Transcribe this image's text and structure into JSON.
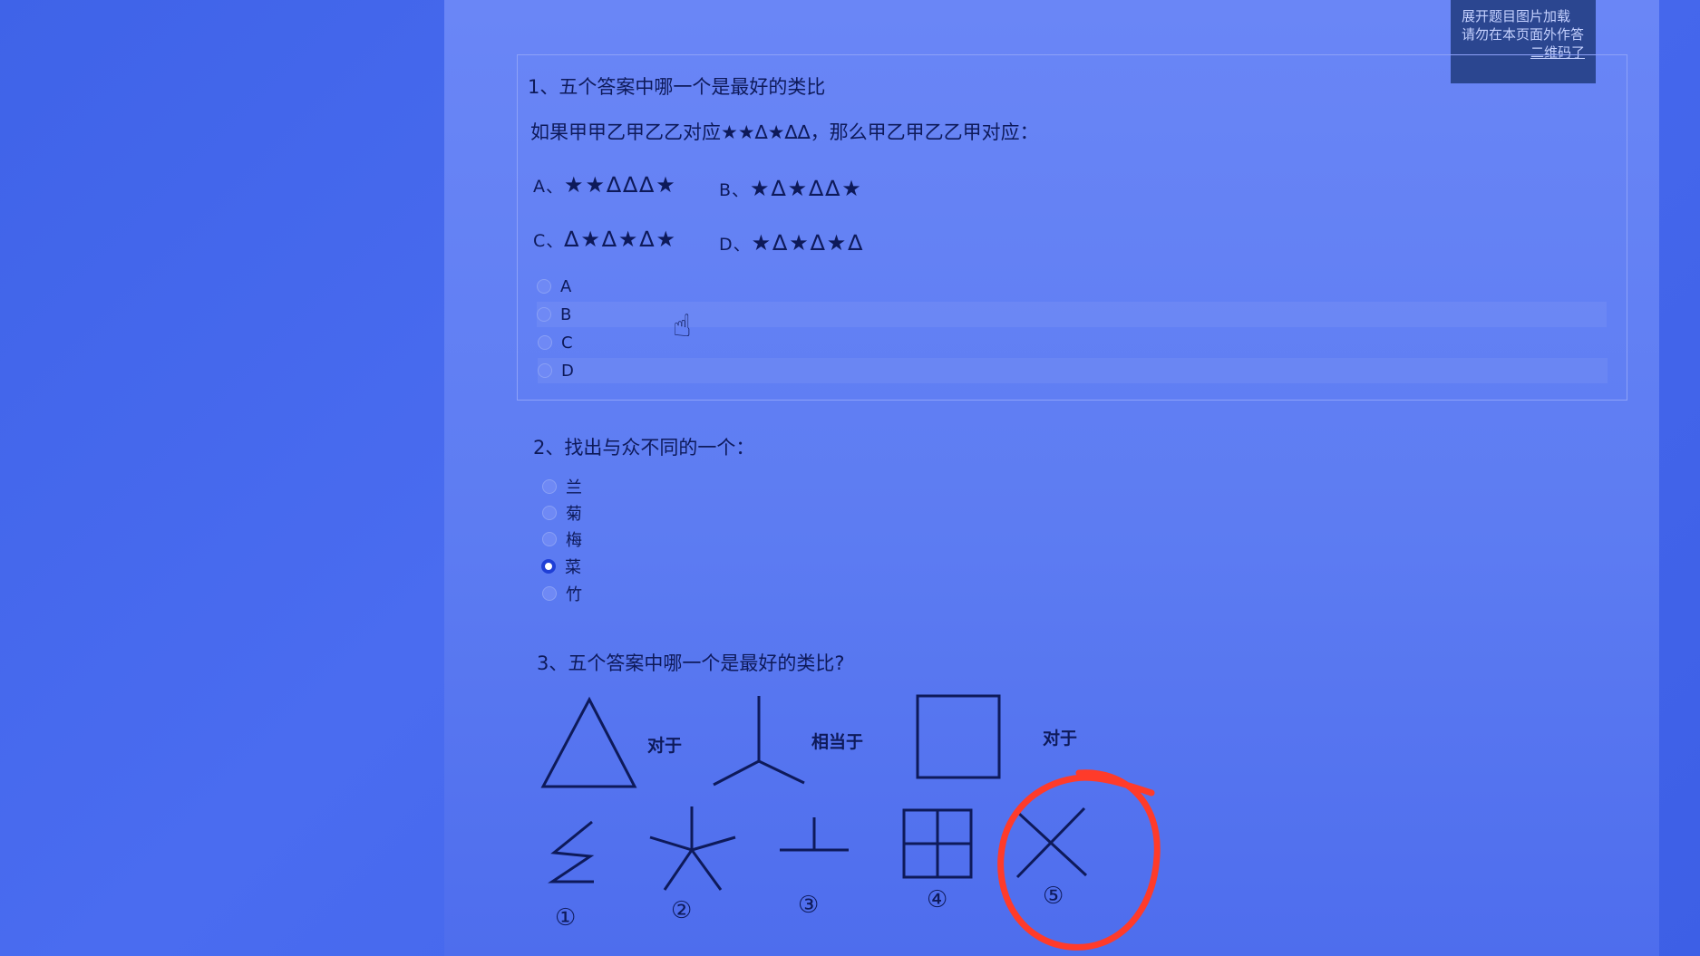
{
  "overlay": {
    "line1": "展开题目图片加载",
    "line2": "请勿在本页面外作答",
    "link": "二维码了"
  },
  "q1": {
    "title": "1、五个答案中哪一个是最好的类比",
    "question": "如果甲甲乙甲乙乙对应★★∆★∆∆，那么甲乙甲乙乙甲对应：",
    "options": [
      {
        "prefix": "A、",
        "symbols": "★★∆∆∆★"
      },
      {
        "prefix": "B、",
        "symbols": "★∆★∆∆★"
      },
      {
        "prefix": "C、",
        "symbols": "∆★∆★∆★"
      },
      {
        "prefix": "D、",
        "symbols": "★∆★∆★∆"
      }
    ],
    "choices": [
      "A",
      "B",
      "C",
      "D"
    ],
    "selected": null
  },
  "q2": {
    "title": "2、找出与众不同的一个：",
    "choices": [
      "兰",
      "菊",
      "梅",
      "菜",
      "竹"
    ],
    "selected": "菜"
  },
  "q3": {
    "title": "3、五个答案中哪一个是最好的类比?",
    "label_pair": "对于",
    "label_equiv": "相当于",
    "label_pair2": "对于",
    "numbers": [
      "①",
      "②",
      "③",
      "④",
      "⑤"
    ]
  },
  "colors": {
    "annotation_circle": "#ff3b2a",
    "selected_radio": "#1f3fd6"
  }
}
